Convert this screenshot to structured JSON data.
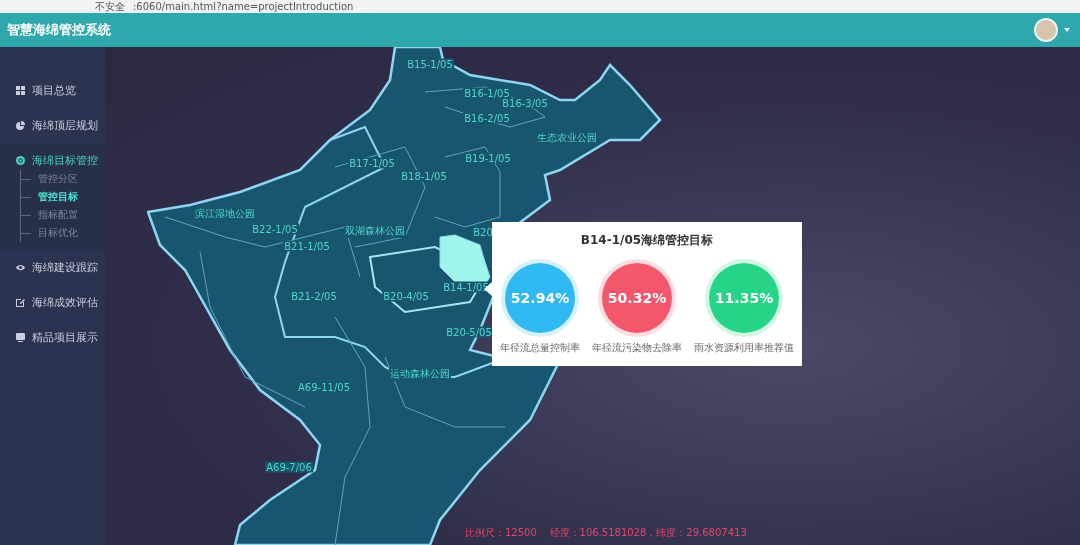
{
  "browser": {
    "security": "不安全",
    "url": ":6060/main.html?name=projectIntroduction"
  },
  "header": {
    "title": "智慧海绵管控系统"
  },
  "sidebar": {
    "items": [
      {
        "label": "项目总览",
        "selected": false,
        "kind": "grid"
      },
      {
        "label": "海绵顶层规划",
        "selected": false,
        "kind": "pie"
      },
      {
        "label": "海绵目标管控",
        "expanded": true,
        "selected": true,
        "kind": "target",
        "children": [
          {
            "label": "管控分区",
            "selected": false
          },
          {
            "label": "管控目标",
            "selected": true
          },
          {
            "label": "指标配置",
            "selected": false
          },
          {
            "label": "目标优化",
            "selected": false
          }
        ]
      },
      {
        "label": "海绵建设跟踪",
        "selected": false,
        "kind": "eye"
      },
      {
        "label": "海绵成效评估",
        "selected": false,
        "kind": "edit"
      },
      {
        "label": "精品项目展示",
        "selected": false,
        "kind": "screen"
      }
    ]
  },
  "map": {
    "labels": [
      "B15-1/05",
      "B16-1/05",
      "B16-3/05",
      "B16-2/05",
      "生态农业公园",
      "B17-1/05",
      "B18-1/05",
      "B19-1/05",
      "滨江湿地公园",
      "B22-1/05",
      "双湖森林公园",
      "B20",
      "B21-1/05",
      "B21-2/05",
      "B20-4/05",
      "B14-1/05",
      "B20-5/05",
      "运动森林公园",
      "A69-11/05",
      "A69-7/06"
    ],
    "popup": {
      "title": "B14-1/05海绵管控目标",
      "metrics": [
        {
          "value": "52.94%",
          "label": "年径流总量控制率",
          "color": "#2fb8f2"
        },
        {
          "value": "50.32%",
          "label": "年径流污染物去除率",
          "color": "#f4566c"
        },
        {
          "value": "11.35%",
          "label": "雨水资源利用率推荐值",
          "color": "#26d487"
        }
      ]
    },
    "status": "比例尺：12500    经度：106.5181028，纬度：29.6807413"
  }
}
